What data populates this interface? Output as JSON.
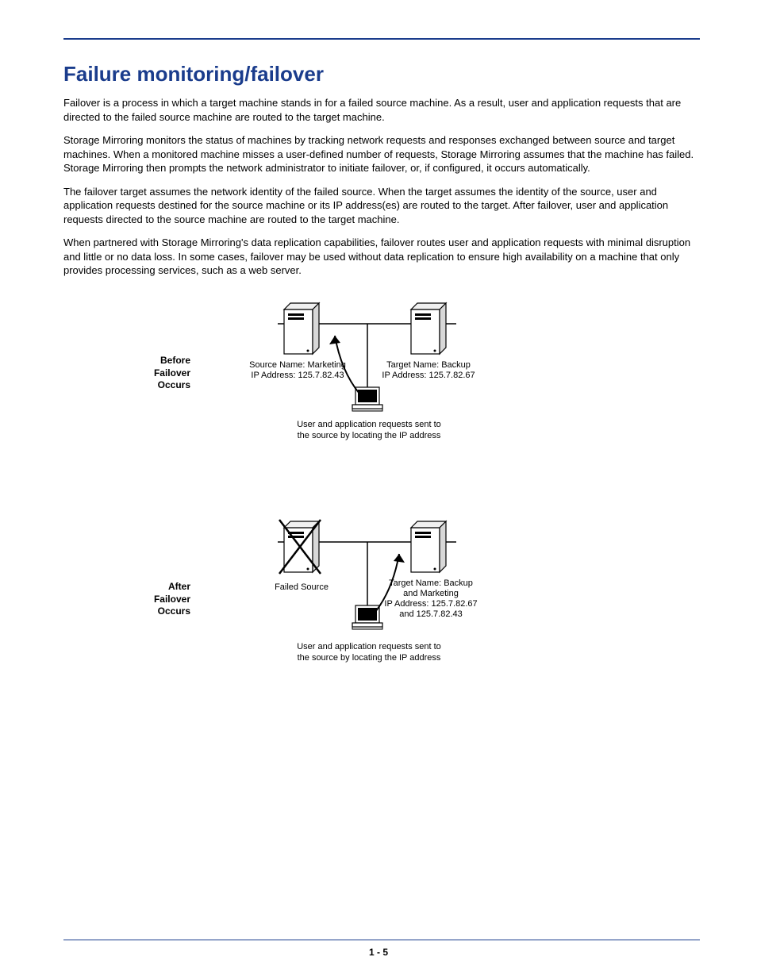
{
  "heading": "Failure monitoring/failover",
  "paragraphs": {
    "p1": "Failover is a process in which a target machine stands in for a failed source machine. As a result, user and application requests that are directed to the failed source machine are routed to the target machine.",
    "p2": "Storage Mirroring monitors the status of machines by tracking network requests and responses exchanged between source and target machines. When a monitored machine misses a user-defined number of requests, Storage Mirroring assumes that the machine has failed. Storage Mirroring then prompts the network administrator to initiate failover, or, if configured, it occurs automatically.",
    "p3": "The failover target assumes the network identity of the failed source. When the target assumes the identity of the source, user and application requests destined for the source machine or its IP address(es) are routed to the target. After failover, user and application requests directed to the source machine are routed to the target machine.",
    "p4": "When partnered with Storage Mirroring's data replication capabilities, failover routes user and application requests with minimal disruption and little or no data loss. In some cases, failover may be used without data replication to ensure high availability on a machine that only provides processing services, such as a web server."
  },
  "diagram1": {
    "side_l1": "Before",
    "side_l2": "Failover",
    "side_l3": "Occurs",
    "source_name": "Source Name: Marketing",
    "source_ip": "IP Address: 125.7.82.43",
    "target_name": "Target Name: Backup",
    "target_ip": "IP Address: 125.7.82.67",
    "caption_l1": "User and application requests sent to",
    "caption_l2": "the source by locating the IP address"
  },
  "diagram2": {
    "side_l1": "After",
    "side_l2": "Failover",
    "side_l3": "Occurs",
    "failed": "Failed Source",
    "target_l1": "Target Name: Backup",
    "target_l2": "and Marketing",
    "target_l3": "IP Address: 125.7.82.67",
    "target_l4": "and 125.7.82.43",
    "caption_l1": "User and application requests sent to",
    "caption_l2": "the source by locating the IP address"
  },
  "page_number": "1 - 5"
}
